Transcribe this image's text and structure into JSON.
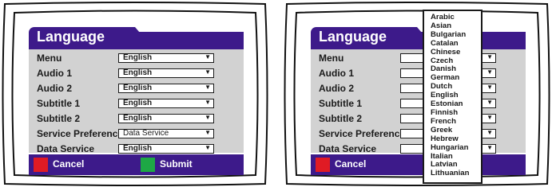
{
  "left_screen": {
    "title": "Language",
    "rows": [
      {
        "label": "Menu",
        "value": "English"
      },
      {
        "label": "Audio 1",
        "value": "English"
      },
      {
        "label": "Audio 2",
        "value": "English"
      },
      {
        "label": "Subtitle 1",
        "value": "English"
      },
      {
        "label": "Subtitle 2",
        "value": "English"
      },
      {
        "label": "Service Preference",
        "value": "Data Service"
      },
      {
        "label": "Data Service",
        "value": "English"
      }
    ],
    "footer": {
      "cancel_label": "Cancel",
      "cancel_color": "#e01b24",
      "submit_label": "Submit",
      "submit_color": "#1ea845"
    }
  },
  "right_screen": {
    "title": "Language",
    "rows": [
      {
        "label": "Menu"
      },
      {
        "label": "Audio 1"
      },
      {
        "label": "Audio 2"
      },
      {
        "label": "Subtitle 1"
      },
      {
        "label": "Subtitle 2"
      },
      {
        "label": "Service Preference"
      },
      {
        "label": "Data Service"
      }
    ],
    "footer": {
      "cancel_label": "Cancel",
      "cancel_color": "#e01b24"
    },
    "dropdown_options": [
      "Arabic",
      "Asian",
      "Bulgarian",
      "Catalan",
      "Chinese",
      "Czech",
      "Danish",
      "German",
      "Dutch",
      "English",
      "Estonian",
      "Finnish",
      "French",
      "Greek",
      "Hebrew",
      "Hungarian",
      "Italian",
      "Latvian",
      "Lithuanian"
    ]
  },
  "colors": {
    "menu_purple": "#3d1a8a",
    "panel_gray": "#d2d2d2"
  },
  "icons": {
    "select_arrow": "triangle-down-icon"
  }
}
